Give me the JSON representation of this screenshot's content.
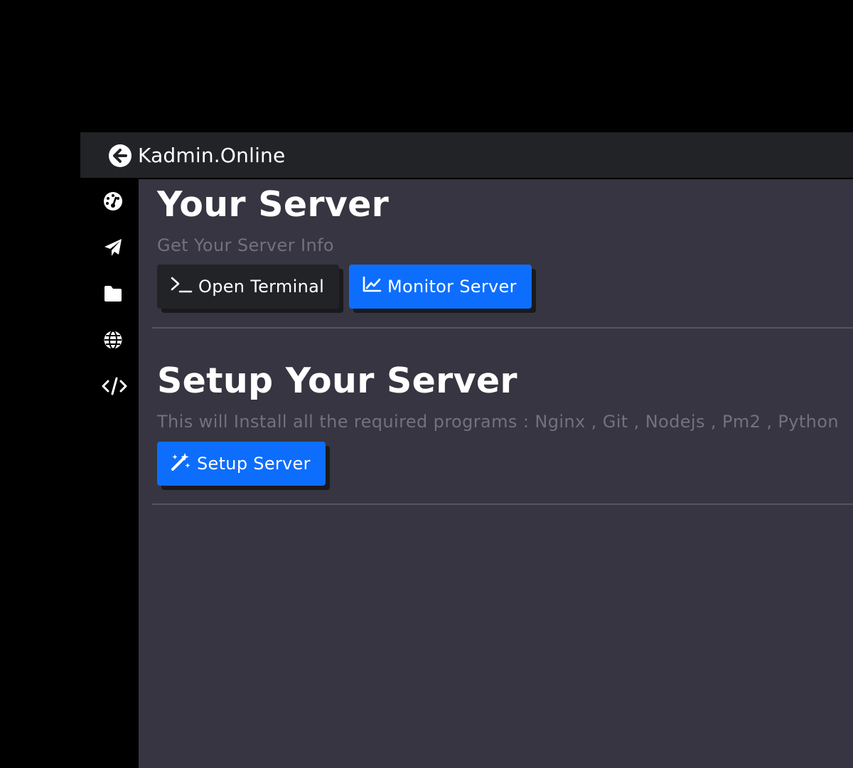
{
  "app": {
    "brand": "Kadmin.Online"
  },
  "sidebar": {
    "items": [
      {
        "icon": "dashboard-gauge-icon"
      },
      {
        "icon": "paper-plane-icon"
      },
      {
        "icon": "folder-icon"
      },
      {
        "icon": "globe-icon"
      },
      {
        "icon": "code-icon"
      }
    ]
  },
  "server_section": {
    "title": "Your Server",
    "subtitle": "Get Your Server Info",
    "open_terminal_label": "Open Terminal",
    "monitor_server_label": "Monitor Server"
  },
  "setup_section": {
    "title": "Setup Your Server",
    "subtitle": "This will Install all the required programs : Nginx , Git , Nodejs , Pm2 , Python",
    "setup_server_label": "Setup Server"
  },
  "colors": {
    "page_bg": "#000000",
    "topbar_bg": "#222326",
    "main_bg": "#363541",
    "accent_blue": "#0d6efd",
    "muted_text": "#73717f"
  }
}
